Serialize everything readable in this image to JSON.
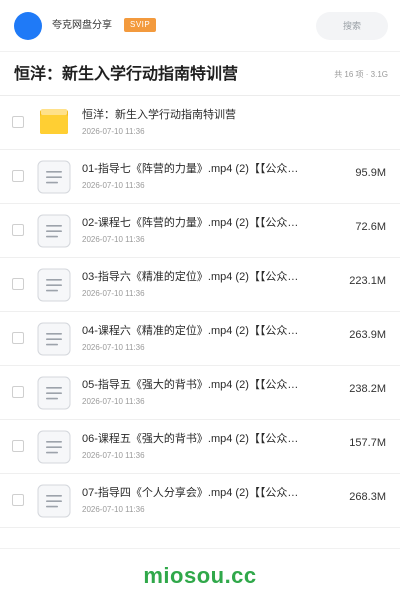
{
  "header": {
    "brand": "夸克网盘分享",
    "badge": "SVIP",
    "search_placeholder": "搜索"
  },
  "titlebar": {
    "title": "恒洋：新生入学行动指南特训营",
    "summary": "共 16 项 · 3.1G"
  },
  "icons": {
    "folder": "folder-icon",
    "file": "document-file-icon",
    "avatar": "avatar"
  },
  "colors": {
    "brand_blue": "#1f7af7",
    "svip_orange": "#f39a3d",
    "folder_yellow": "#f5bd1f",
    "watermark_green": "#30a84a"
  },
  "files": [
    {
      "type": "folder",
      "name": "恒洋：新生入学行动指南特训营",
      "time": "2026-07-10 11:36",
      "size": ""
    },
    {
      "type": "file",
      "name": "01-指导七《阵营的力量》.mp4 (2)【【公众号：...",
      "time": "2026-07-10 11:36",
      "size": "95.9M"
    },
    {
      "type": "file",
      "name": "02-课程七《阵营的力量》.mp4 (2)【【公众号：...",
      "time": "2026-07-10 11:36",
      "size": "72.6M"
    },
    {
      "type": "file",
      "name": "03-指导六《精准的定位》.mp4 (2)【【公众号：...",
      "time": "2026-07-10 11:36",
      "size": "223.1M"
    },
    {
      "type": "file",
      "name": "04-课程六《精准的定位》.mp4 (2)【【公众号：...",
      "time": "2026-07-10 11:36",
      "size": "263.9M"
    },
    {
      "type": "file",
      "name": "05-指导五《强大的背书》.mp4 (2)【【公众号：...",
      "time": "2026-07-10 11:36",
      "size": "238.2M"
    },
    {
      "type": "file",
      "name": "06-课程五《强大的背书》.mp4 (2)【【公众号：...",
      "time": "2026-07-10 11:36",
      "size": "157.7M"
    },
    {
      "type": "file",
      "name": "07-指导四《个人分享会》.mp4 (2)【【公众号：...",
      "time": "2026-07-10 11:36",
      "size": "268.3M"
    }
  ],
  "footer": {
    "watermark": "miosou.cc"
  }
}
